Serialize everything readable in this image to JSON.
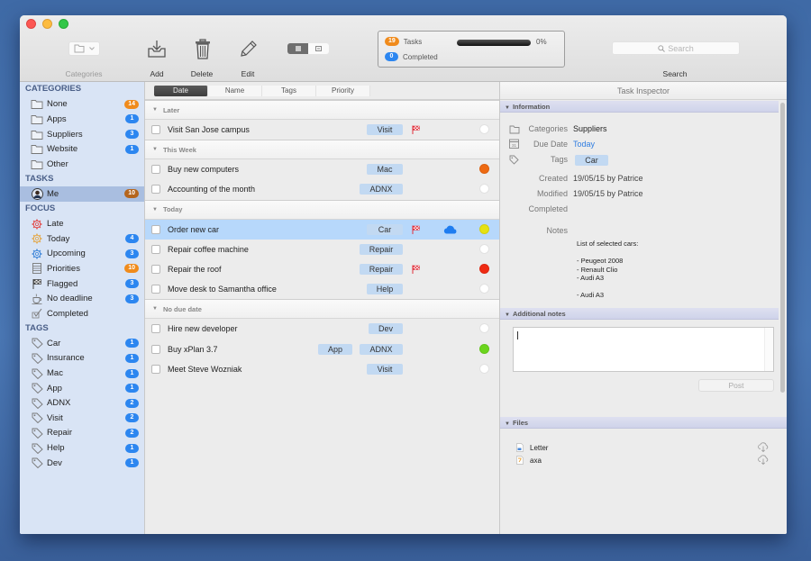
{
  "window": {
    "controls": [
      "close",
      "minimize",
      "maximize"
    ]
  },
  "toolbar": {
    "categories_label": "Categories",
    "add_label": "Add",
    "delete_label": "Delete",
    "edit_label": "Edit",
    "search_label": "Search",
    "search_placeholder": "Search",
    "view_modes": [
      "list",
      "detail"
    ],
    "active_view": "list",
    "status": {
      "tasks_count": "19",
      "tasks_label": "Tasks",
      "completed_count": "0",
      "completed_label": "Completed",
      "progress_percent": 0,
      "progress_text": "0%"
    }
  },
  "sidebar": {
    "categories_header": "CATEGORIES",
    "categories": [
      {
        "label": "None",
        "count": "14",
        "badge_color": "orange",
        "icon": "folder-icon"
      },
      {
        "label": "Apps",
        "count": "1",
        "badge_color": "blue",
        "icon": "folder-icon"
      },
      {
        "label": "Suppliers",
        "count": "3",
        "badge_color": "blue",
        "icon": "folder-icon"
      },
      {
        "label": "Website",
        "count": "1",
        "badge_color": "blue",
        "icon": "folder-icon"
      },
      {
        "label": "Other",
        "count": null,
        "icon": "folder-icon"
      }
    ],
    "tasks_header": "TASKS",
    "tasks": [
      {
        "label": "Me",
        "count": "10",
        "badge_color": "brown",
        "icon": "avatar",
        "selected": true
      }
    ],
    "focus_header": "FOCUS",
    "focus": [
      {
        "label": "Late",
        "count": null,
        "icon": "gear-red-icon"
      },
      {
        "label": "Today",
        "count": "4",
        "badge_color": "blue",
        "icon": "gear-orange-icon"
      },
      {
        "label": "Upcoming",
        "count": "3",
        "badge_color": "blue",
        "icon": "gear-blue-icon"
      },
      {
        "label": "Priorities",
        "count": "10",
        "badge_color": "orange",
        "icon": "list-icon"
      },
      {
        "label": "Flagged",
        "count": "3",
        "badge_color": "blue",
        "icon": "flag-icon"
      },
      {
        "label": "No deadline",
        "count": "3",
        "badge_color": "blue",
        "icon": "coffee-icon"
      },
      {
        "label": "Completed",
        "count": null,
        "icon": "checkmark-icon"
      }
    ],
    "tags_header": "TAGS",
    "tags": [
      {
        "label": "Car",
        "count": "1"
      },
      {
        "label": "Insurance",
        "count": "1"
      },
      {
        "label": "Mac",
        "count": "1"
      },
      {
        "label": "App",
        "count": "1"
      },
      {
        "label": "ADNX",
        "count": "2"
      },
      {
        "label": "Visit",
        "count": "2"
      },
      {
        "label": "Repair",
        "count": "2"
      },
      {
        "label": "Help",
        "count": "1"
      },
      {
        "label": "Dev",
        "count": "1"
      }
    ]
  },
  "task_list": {
    "sort_tabs": [
      "Date",
      "Name",
      "Tags",
      "Priority"
    ],
    "active_sort": "Date",
    "groups": [
      {
        "name": "Later",
        "tasks": [
          {
            "title": "Visit San Jose campus",
            "tags": [
              "Visit"
            ],
            "flagged": true,
            "cloud": false,
            "priority": "none",
            "selected": false
          }
        ]
      },
      {
        "name": "This Week",
        "tasks": [
          {
            "title": "Buy new computers",
            "tags": [
              "Mac"
            ],
            "flagged": false,
            "cloud": false,
            "priority": "high",
            "selected": false
          },
          {
            "title": "Accounting of the month",
            "tags": [
              "ADNX"
            ],
            "flagged": false,
            "cloud": false,
            "priority": "none",
            "selected": false
          }
        ]
      },
      {
        "name": "Today",
        "tasks": [
          {
            "title": "Order new car",
            "tags": [
              "Car"
            ],
            "flagged": true,
            "cloud": true,
            "priority": "medium",
            "selected": true
          },
          {
            "title": "Repair coffee machine",
            "tags": [
              "Repair"
            ],
            "flagged": false,
            "cloud": false,
            "priority": "none",
            "selected": false
          },
          {
            "title": "Repair the roof",
            "tags": [
              "Repair"
            ],
            "flagged": true,
            "cloud": false,
            "priority": "urgent",
            "selected": false
          },
          {
            "title": "Move desk to Samantha office",
            "tags": [
              "Help"
            ],
            "flagged": false,
            "cloud": false,
            "priority": "none",
            "selected": false
          }
        ]
      },
      {
        "name": "No due date",
        "tasks": [
          {
            "title": "Hire new developer",
            "tags": [
              "Dev"
            ],
            "flagged": false,
            "cloud": false,
            "priority": "none",
            "selected": false
          },
          {
            "title": "Buy xPlan 3.7",
            "tags": [
              "App",
              "ADNX"
            ],
            "flagged": false,
            "cloud": false,
            "priority": "low",
            "selected": false
          },
          {
            "title": "Meet Steve Wozniak",
            "tags": [
              "Visit"
            ],
            "flagged": false,
            "cloud": false,
            "priority": "none",
            "selected": false
          }
        ]
      }
    ]
  },
  "colors": {
    "priority": {
      "none": "#ffffff",
      "high": "#ee6a12",
      "medium": "#e6e213",
      "urgent": "#ef2a12",
      "low": "#6bd51d"
    },
    "badge": {
      "orange": "#f08b1c",
      "blue": "#2c86f0",
      "brown": "#b5651d"
    },
    "accent_link": "#2f7de1",
    "flag": "#e0313d",
    "cloud": "#1f7df0"
  },
  "inspector": {
    "title": "Task Inspector",
    "information_header": "Information",
    "fields": {
      "categories_label": "Categories",
      "categories_value": "Suppliers",
      "due_label": "Due Date",
      "due_value": "Today",
      "tags_label": "Tags",
      "tags_value": "Car",
      "created_label": "Created",
      "created_value": "19/05/15 by Patrice",
      "modified_label": "Modified",
      "modified_value": "19/05/15 by Patrice",
      "completed_label": "Completed",
      "completed_value": "",
      "notes_label": "Notes",
      "notes_value": "List of selected cars:\n\n- Peugeot 2008\n- Renault Clio\n- Audi A3\n\n- Audi A3"
    },
    "additional_notes_header": "Additional notes",
    "additional_notes_value": "",
    "post_label": "Post",
    "files_header": "Files",
    "files": [
      {
        "name": "Letter",
        "icon": "document-icon"
      },
      {
        "name": "axa",
        "icon": "pdf-icon"
      }
    ]
  }
}
